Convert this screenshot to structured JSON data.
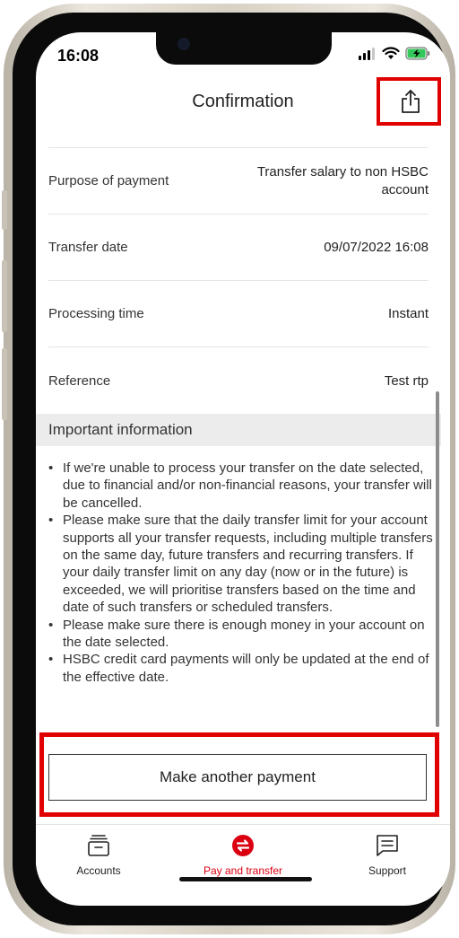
{
  "status_bar": {
    "time": "16:08"
  },
  "header": {
    "title": "Confirmation",
    "share_icon": "share-icon"
  },
  "details": [
    {
      "label": "Purpose of payment",
      "value": "Transfer salary to non HSBC account"
    },
    {
      "label": "Transfer date",
      "value": "09/07/2022 16:08"
    },
    {
      "label": "Processing time",
      "value": "Instant"
    },
    {
      "label": "Reference",
      "value": "Test rtp"
    }
  ],
  "important_info": {
    "title": "Important information",
    "items": [
      "If we're unable to process your transfer on the date selected, due to financial and/or non-financial reasons, your transfer will be cancelled.",
      "Please make sure that the daily transfer limit for your account supports all your transfer requests, including multiple transfers on the same day, future transfers and recurring transfers. If your daily transfer limit on any day (now or in the future) is exceeded, we will prioritise transfers based on the time and date of such transfers or scheduled transfers.",
      "Please make sure there is enough money in your account on the date selected.",
      "HSBC credit card payments will only be updated at the end of the effective date."
    ]
  },
  "actions": {
    "make_another_payment": "Make another payment"
  },
  "tabbar": {
    "tabs": [
      {
        "label": "Accounts",
        "icon": "wallet-icon"
      },
      {
        "label": "Pay and transfer",
        "icon": "transfer-icon",
        "active": true
      },
      {
        "label": "Support",
        "icon": "chat-icon"
      }
    ]
  },
  "colors": {
    "accent": "#db0011",
    "highlight": "#e00000"
  }
}
